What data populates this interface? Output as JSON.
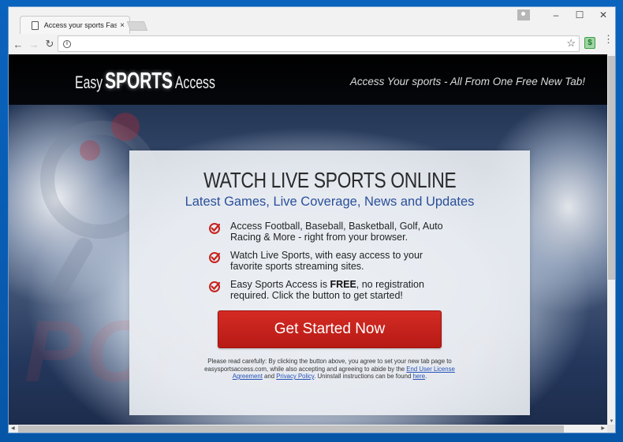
{
  "browser": {
    "tab": {
      "title": "Access your sports Faster",
      "close_glyph": "×"
    },
    "window_controls": {
      "minimize": "–",
      "maximize": "☐",
      "close": "✕"
    },
    "nav": {
      "back": "←",
      "forward": "→",
      "reload": "↻"
    },
    "address": {
      "value": "",
      "placeholder": "",
      "info_glyph": "i"
    },
    "star_glyph": "☆",
    "extension_glyph": "$",
    "menu_glyph": "⋮"
  },
  "page": {
    "logo": {
      "easy": "Easy",
      "sports": "SPORTS",
      "access": "Access"
    },
    "tagline": "Access Your sports - All From One Free New Tab!",
    "card": {
      "title": "WATCH LIVE SPORTS ONLINE",
      "subtitle": "Latest Games, Live Coverage, News and Updates",
      "features": [
        {
          "text": "Access Football, Baseball, Basketball, Golf, Auto Racing & More - right from your browser."
        },
        {
          "text": "Watch Live Sports, with easy access to your favorite sports streaming sites."
        },
        {
          "pre": "Easy Sports Access is ",
          "bold": "FREE",
          "post": ", no registration required. Click the button to get started!"
        }
      ],
      "cta_label": "Get Started Now",
      "disclaimer": {
        "part1": "Please read carefully: By clicking the button above, you agree to set your new tab page to easysportsaccess.com, while also accepting and agreeing to abide by the ",
        "eula_link": "End User License Agreement",
        "and": " and ",
        "privacy_link": "Privacy Policy",
        "part2": ". Uninstall instructions can be found ",
        "here_link": "here",
        "end": "."
      }
    },
    "watermark": "PCrisk.com"
  },
  "colors": {
    "accent_red": "#c7221c",
    "subtitle_blue": "#2a4f9a",
    "link_blue": "#2451b5",
    "desktop_blue": "#0a63bd"
  }
}
